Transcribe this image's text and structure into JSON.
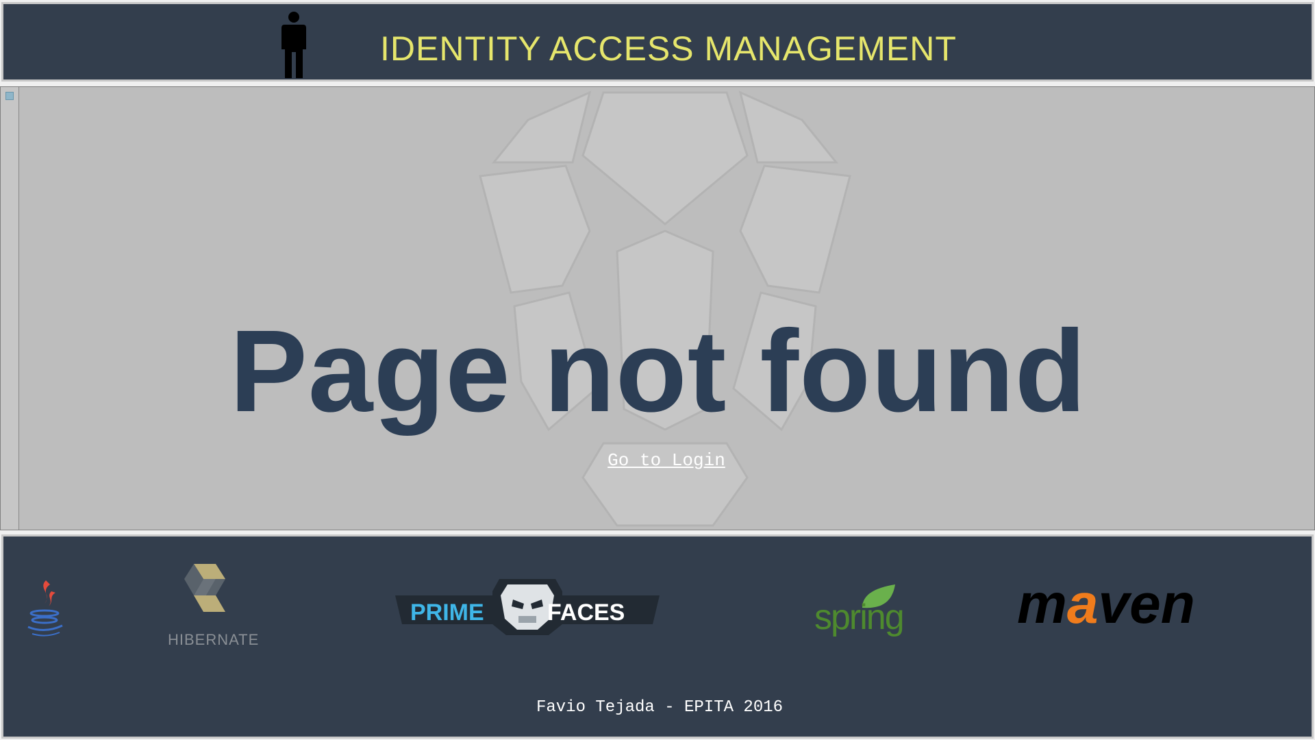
{
  "header": {
    "title": "IDENTITY ACCESS MANAGEMENT",
    "title_color": "#e6e66c",
    "icon": "person-icon"
  },
  "main": {
    "heading": "Page not found",
    "heading_color": "#2c3e55",
    "link_label": "Go to Login",
    "watermark": "primefaces-mask-watermark"
  },
  "footer": {
    "logos": {
      "java": "java-logo",
      "hibernate": "HIBERNATE",
      "primefaces_left": "PRIME",
      "primefaces_right": "FACES",
      "spring": "spring",
      "maven_m": "m",
      "maven_a": "a",
      "maven_rest": "ven"
    },
    "credit": "Favio Tejada - EPITA 2016"
  },
  "colors": {
    "panel_bg": "#333e4d",
    "content_bg": "#bdbdbd"
  }
}
